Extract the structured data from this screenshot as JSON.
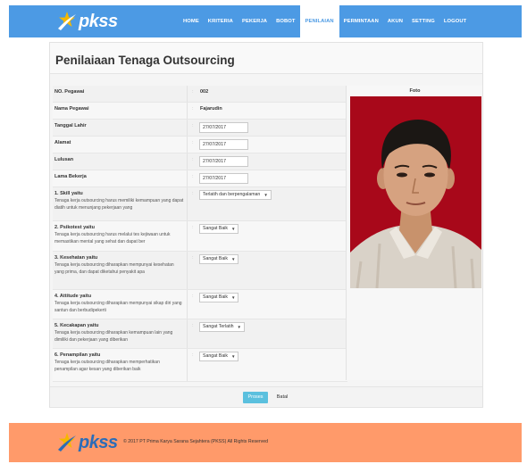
{
  "brand": {
    "name": "pkss",
    "logo_icon": "star-swoosh-logo"
  },
  "nav": {
    "items": [
      {
        "label": "HOME",
        "active": false
      },
      {
        "label": "KRITERIA",
        "active": false
      },
      {
        "label": "PEKERJA",
        "active": false
      },
      {
        "label": "BOBOT",
        "active": false
      },
      {
        "label": "PENILAIAN",
        "active": true
      },
      {
        "label": "PERMINTAAN",
        "active": false
      },
      {
        "label": "AKUN",
        "active": false
      },
      {
        "label": "SETTING",
        "active": false
      },
      {
        "label": "LOGOUT",
        "active": false
      }
    ]
  },
  "page": {
    "title": "Penilaiaan Tenaga Outsourcing"
  },
  "form": {
    "separator": ":",
    "no_pegawai": {
      "label": "NO. Pegawai",
      "value": "002"
    },
    "nama_pegawai": {
      "label": "Nama Pegawai",
      "value": "Fajarudin"
    },
    "tanggal_lahir": {
      "label": "Tanggal Lahir",
      "value": "27/07/2017"
    },
    "alamat": {
      "label": "Alamat",
      "value": "27/07/2017"
    },
    "lulusan": {
      "label": "Lulusan",
      "value": "27/07/2017"
    },
    "lama_bekerja": {
      "label": "Lama Bekerja",
      "value": "27/07/2017"
    },
    "criteria": [
      {
        "label": "1. Skill yaitu",
        "desc": "Tenaga kerja outsourcing harus memiliki kemampuan yang dapat diatih untuk menunjang pekerjaan yang",
        "selected": "Terlatih dan berpengalaman"
      },
      {
        "label": "2. Psikotest yaitu",
        "desc": "Tenaga kerja outsourcing harus melalui tes kejiwaan untuk memastikan mental yang sehat dan dapat ber",
        "selected": "Sangat Baik"
      },
      {
        "label": "3. Kesehatan yaitu",
        "desc": "Tenaga kerja outsourcing diharapkan mempunyai kesehatan yang prima, dan dapat diketahui penyakit apa",
        "selected": "Sangat Baik"
      },
      {
        "label": "4. Attitude yaitu",
        "desc": "Tenaga kerja outsourcing diharapkan mempunyai sikap diri yang santun dan berbudipekerti",
        "selected": "Sangat Baik"
      },
      {
        "label": "5. Kecakapan yaitu",
        "desc": "Tenaga kerja outsourcing diharapkan kemampuan lain yang dimiliki dan pekerjaan yang diberikan",
        "selected": "Sangat Terlatih"
      },
      {
        "label": "6. Penampilan yaitu",
        "desc": "Tenaga kerja outsourcing diharapkan memperhatikan penampilan agar kesan yang diberikan baik",
        "selected": "Sangat Baik"
      }
    ]
  },
  "photo": {
    "label": "Foto"
  },
  "actions": {
    "submit_label": "Proses",
    "cancel_label": "Batal"
  },
  "footer": {
    "copyright": "© 2017 PT Prima Karya Sarana Sejahtera (PKSS) All Rights Reserved"
  },
  "colors": {
    "navbar": "#4c9ae4",
    "footer": "#ff9a6a",
    "button": "#5bc0de",
    "photo_bg": "#a8081a"
  }
}
